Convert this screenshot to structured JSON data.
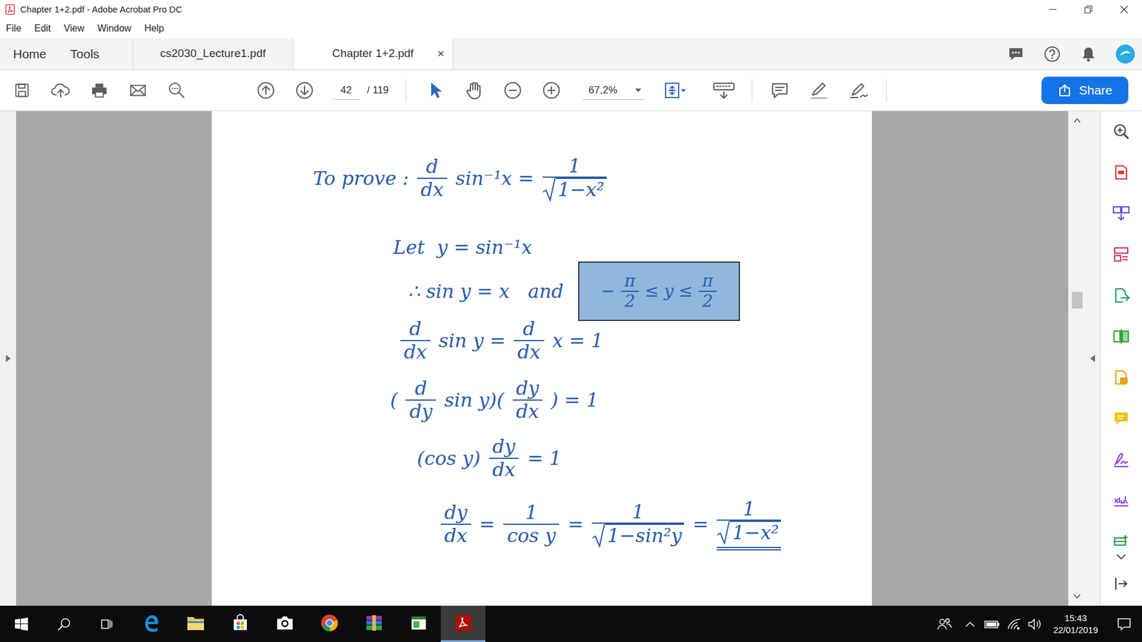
{
  "window": {
    "title": "Chapter 1+2.pdf - Adobe Acrobat Pro DC"
  },
  "menu": [
    "File",
    "Edit",
    "View",
    "Window",
    "Help"
  ],
  "nav": [
    "Home",
    "Tools"
  ],
  "tabs": [
    {
      "label": "cs2030_Lecture1.pdf",
      "selected": false
    },
    {
      "label": "Chapter 1+2.pdf",
      "selected": true,
      "close": "×"
    }
  ],
  "toolbar": {
    "page": "42",
    "page_total": "/ 119",
    "zoom": "67,2%",
    "share": "Share"
  },
  "document": {
    "lines": [
      {
        "parts": [
          {
            "kind": "text",
            "text": "To prove :"
          },
          {
            "kind": "frac",
            "num": "d",
            "den": "dx",
            "sqrt": false,
            "underlined": false
          },
          {
            "kind": "text",
            "text": "sin⁻¹x ="
          },
          {
            "kind": "frac",
            "num": "1",
            "den": "1−x²",
            "sqrt": true,
            "underlined": false
          }
        ]
      },
      {
        "parts": [
          {
            "kind": "text",
            "text": "Let  y = sin⁻¹x"
          }
        ]
      },
      {
        "parts": [
          {
            "kind": "text",
            "text": "∴ sin y = x   and"
          },
          {
            "kind": "box",
            "highlight": true,
            "parts": [
              {
                "kind": "text",
                "text": "−"
              },
              {
                "kind": "frac",
                "num": "π",
                "den": "2",
                "sqrt": false,
                "underlined": false
              },
              {
                "kind": "text",
                "text": "≤ y ≤"
              },
              {
                "kind": "frac",
                "num": "π",
                "den": "2",
                "sqrt": false,
                "underlined": false
              }
            ]
          }
        ]
      },
      {
        "parts": [
          {
            "kind": "frac",
            "num": "d",
            "den": "dx",
            "sqrt": false,
            "underlined": false
          },
          {
            "kind": "text",
            "text": "sin y ="
          },
          {
            "kind": "frac",
            "num": "d",
            "den": "dx",
            "sqrt": false,
            "underlined": false
          },
          {
            "kind": "text",
            "text": "x = 1"
          }
        ]
      },
      {
        "parts": [
          {
            "kind": "text",
            "text": "("
          },
          {
            "kind": "frac",
            "num": "d",
            "den": "dy",
            "sqrt": false,
            "underlined": false
          },
          {
            "kind": "text",
            "text": "sin y)("
          },
          {
            "kind": "frac",
            "num": "dy",
            "den": "dx",
            "sqrt": false,
            "underlined": false
          },
          {
            "kind": "text",
            "text": ") = 1"
          }
        ]
      },
      {
        "parts": [
          {
            "kind": "text",
            "text": "(cos y)"
          },
          {
            "kind": "frac",
            "num": "dy",
            "den": "dx",
            "sqrt": false,
            "underlined": false
          },
          {
            "kind": "text",
            "text": "= 1"
          }
        ]
      },
      {
        "parts": [
          {
            "kind": "frac",
            "num": "dy",
            "den": "dx",
            "sqrt": false,
            "underlined": false
          },
          {
            "kind": "text",
            "text": "="
          },
          {
            "kind": "frac",
            "num": "1",
            "den": "cos y",
            "sqrt": false,
            "underlined": false
          },
          {
            "kind": "text",
            "text": "="
          },
          {
            "kind": "frac",
            "num": "1",
            "den": "1−sin²y",
            "sqrt": true,
            "underlined": false
          },
          {
            "kind": "text",
            "text": "="
          },
          {
            "kind": "frac",
            "num": "1",
            "den": "1−x²",
            "sqrt": true,
            "underlined": true
          }
        ]
      }
    ]
  },
  "taskbar": {
    "apps": [
      {
        "active": false
      },
      {
        "active": false
      },
      {
        "active": false
      },
      {
        "active": false
      },
      {
        "active": false
      },
      {
        "active": false
      },
      {
        "active": false
      },
      {
        "active": true
      }
    ],
    "time": "15:43",
    "date": "22/01/2019"
  }
}
